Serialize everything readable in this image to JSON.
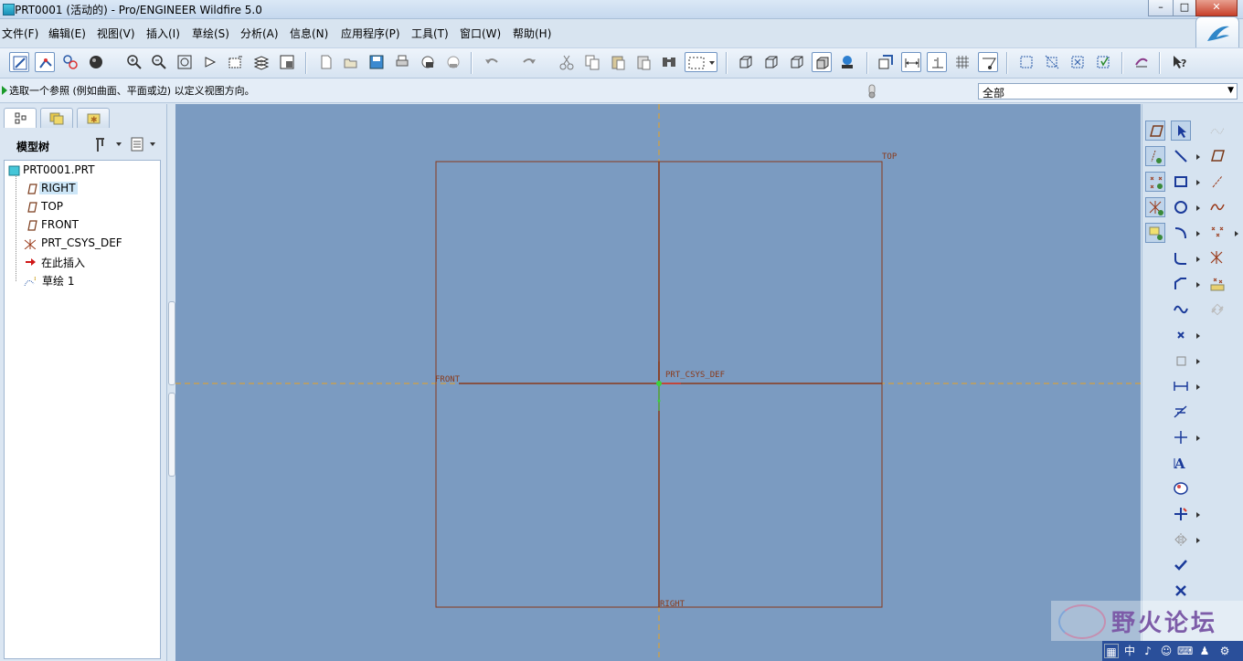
{
  "window": {
    "title": "PRT0001 (活动的) - Pro/ENGINEER Wildfire 5.0",
    "minimize": "–",
    "maximize": "□",
    "close": "✕"
  },
  "menubar": {
    "items": [
      "文件(F)",
      "编辑(E)",
      "视图(V)",
      "插入(I)",
      "草绘(S)",
      "分析(A)",
      "信息(N)",
      "应用程序(P)",
      "工具(T)",
      "窗口(W)",
      "帮助(H)"
    ]
  },
  "toolbar": {
    "icons": [
      "sketch-display-icon",
      "dimension-display-icon",
      "constraint-display-icon",
      "shading-icon",
      "zoom-in-icon",
      "zoom-out-icon",
      "refit-icon",
      "reorient-icon",
      "named-view-icon",
      "layers-icon",
      "view-manager-icon",
      "new-icon",
      "open-icon",
      "save-icon",
      "print-icon",
      "send-mail-icon",
      "send-link-icon",
      "undo-icon",
      "redo-icon",
      "cut-icon",
      "copy-icon",
      "paste-icon",
      "paste-special-icon",
      "find-icon",
      "selection-box-icon",
      "wireframe-icon",
      "hidden-line-icon",
      "no-hidden-icon",
      "shaded-icon",
      "enhanced-realism-icon",
      "sketch-view-icon",
      "display-dims-icon",
      "display-constraints-icon",
      "display-grid-icon",
      "display-vertices-icon",
      "datum-planes-icon",
      "datum-axes-icon",
      "datum-points-icon",
      "csys-icon",
      "spin-center-icon",
      "context-help-icon"
    ]
  },
  "status": {
    "message": "选取一个参照 (例如曲面、平面或边) 以定义视图方向。",
    "filter_value": "全部"
  },
  "left_panel": {
    "tabs": [
      "model-tree-tab-icon",
      "folder-browser-tab-icon",
      "favorites-tab-icon"
    ],
    "title": "模型树",
    "tree": {
      "root": "PRT0001.PRT",
      "items": [
        {
          "label": "RIGHT",
          "icon": "datum-plane-icon"
        },
        {
          "label": "TOP",
          "icon": "datum-plane-icon"
        },
        {
          "label": "FRONT",
          "icon": "datum-plane-icon"
        },
        {
          "label": "PRT_CSYS_DEF",
          "icon": "csys-icon"
        },
        {
          "label": "在此插入",
          "icon": "insert-here-arrow-icon"
        },
        {
          "label": "草绘 1",
          "icon": "sketch-feature-icon"
        }
      ]
    }
  },
  "canvas": {
    "labels": {
      "top": "TOP",
      "front": "FRONT",
      "right": "RIGHT",
      "csys": "PRT_CSYS_DEF"
    },
    "colors": {
      "background": "#7b9bc1",
      "datum": "#8a3a1a",
      "centerline": "#e8a020",
      "origin": "#3ad43a"
    }
  },
  "sketch_toolbar": {
    "icons": [
      "sketch-plane-icon",
      "select-arrow-icon",
      "centerline-icon",
      "line-icon",
      "datum-plane-icon",
      "dims-toggle-icon",
      "rectangle-icon",
      "datum-axis-icon",
      "constraints-toggle-icon",
      "circle-icon",
      "curve-icon",
      "grid-toggle-icon",
      "arc-icon",
      "datum-point-icon",
      "fillet-icon",
      "csys-icon",
      "chamfer-icon",
      "analysis-icon",
      "spline-icon",
      "link-icon",
      "point-icon",
      "offset-icon",
      "dimension-icon",
      "modify-icon",
      "constrain-icon",
      "text-icon",
      "palette-icon",
      "trim-icon",
      "mirror-icon",
      "accept-check-icon",
      "cancel-x-icon"
    ]
  },
  "watermark": {
    "text": "野火论坛"
  },
  "ime": {
    "cells": [
      "中",
      "♪",
      "☺",
      "⌨",
      "♟",
      "⚙"
    ]
  }
}
